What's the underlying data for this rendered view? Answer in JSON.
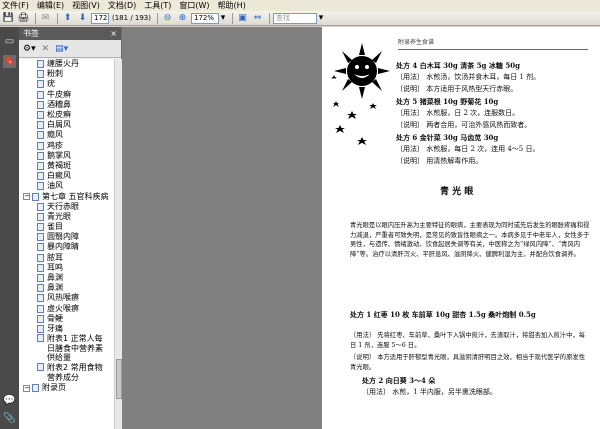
{
  "menubar": {
    "items": [
      "文件(F)",
      "编辑(E)",
      "视图(V)",
      "文档(D)",
      "工具(T)",
      "窗口(W)",
      "帮助(H)"
    ]
  },
  "toolbar": {
    "page_input": "172",
    "page_total": "(181 / 193)",
    "zoom_value": "172%",
    "search_placeholder": "查找"
  },
  "panel": {
    "title": "书签",
    "close": "×"
  },
  "bookmarks": [
    {
      "label": "缠腰火丹",
      "level": 2
    },
    {
      "label": "粉刺",
      "level": 2
    },
    {
      "label": "疣",
      "level": 2
    },
    {
      "label": "牛皮癣",
      "level": 2
    },
    {
      "label": "酒糟鼻",
      "level": 2
    },
    {
      "label": "松皮癣",
      "level": 2
    },
    {
      "label": "白屑风",
      "level": 2
    },
    {
      "label": "瘾风",
      "level": 2
    },
    {
      "label": "鸡疹",
      "level": 2
    },
    {
      "label": "鹅掌风",
      "level": 2
    },
    {
      "label": "黄褐斑",
      "level": 2
    },
    {
      "label": "白癜风",
      "level": 2
    },
    {
      "label": "油风",
      "level": 2
    },
    {
      "label": "第七章 五官科疾病",
      "level": 1
    },
    {
      "label": "天行赤眼",
      "level": 2
    },
    {
      "label": "青光眼",
      "level": 2
    },
    {
      "label": "雀目",
      "level": 2
    },
    {
      "label": "圆翳内障",
      "level": 2
    },
    {
      "label": "暴内障睛",
      "level": 2
    },
    {
      "label": "脓耳",
      "level": 2
    },
    {
      "label": "耳鸣",
      "level": 2
    },
    {
      "label": "鼻渊",
      "level": 2
    },
    {
      "label": "鼻渊",
      "level": 2
    },
    {
      "label": "风热喉痹",
      "level": 2
    },
    {
      "label": "虚火喉痹",
      "level": 2
    },
    {
      "label": "骨鲠",
      "level": 2
    },
    {
      "label": "牙痛",
      "level": 2
    },
    {
      "label": "附表1 正常人每日膳食中营养素供给量",
      "level": 2,
      "lines": 3
    },
    {
      "label": "附表2 常用食物营养成分",
      "level": 2,
      "lines": 2
    },
    {
      "label": "附录页",
      "level": 1
    }
  ],
  "document": {
    "header_text": "附录养生食谱",
    "lines": [
      {
        "text": "处方 4   白木耳 30g   清茶 5g   冰糖 50g",
        "bold_prefix": true
      },
      {
        "text": "〔用法〕  水煎汤，饮汤并食木耳，每日 1 剂。"
      },
      {
        "text": "〔说明〕  本方适用于风热型天行赤眼。"
      },
      {
        "text": "处方 5   猪菜根 10g   野菊花 10g",
        "bold_prefix": true
      },
      {
        "text": "〔用法〕  水煎服，日 2 次，连服数日。"
      },
      {
        "text": "〔说明〕  两者合用，可治外感风热而致者。"
      },
      {
        "text": "处方 6   金针菜 30g   马齿苋 30g",
        "bold_prefix": true
      },
      {
        "text": "〔用法〕  水煎服，每日 2 次，连用 4～5 日。"
      },
      {
        "text": "〔说明〕  用清热解毒作用。"
      }
    ],
    "section_title": "青 光 眼",
    "paragraph": "青光眼是以眼内压升高为主要特征的眼病，主要表现为同时或先后发生的眼胀疼痛和视力减退，严重者可致失明，是常见的致盲性眼病之一。本病多见于中老年人，女性多于男性，与遗传、情绪激动、饮食起居失调等有关，中医称之为“绿风内障”、“青风内障”等。治疗以清肝泻火、平肝息风、滋阴降火、健脾利湿为主，并配合饮食调养。",
    "lines2": [
      {
        "text": "处方 1   红枣 10 枚   车前草 10g   甜杏 1.5g   桑叶炮制 0.5g"
      },
      {
        "text": "〔用法〕  先将红枣、车前草、桑叶下入锅中煎汁，去渣取汁，将甜杏加入煎汁中，每日 1 剂，连服 5～6 日。"
      },
      {
        "text": "〔说明〕  本方适用于肝郁型青光眼，具滋阴清肝明目之效，相当于现代医学的原发性青光眼。"
      },
      {
        "text": "处方 2   向日葵 3～4 朵"
      },
      {
        "text": "〔用法〕  水煎，1 半内服，另半熏洗眼部。"
      }
    ]
  }
}
